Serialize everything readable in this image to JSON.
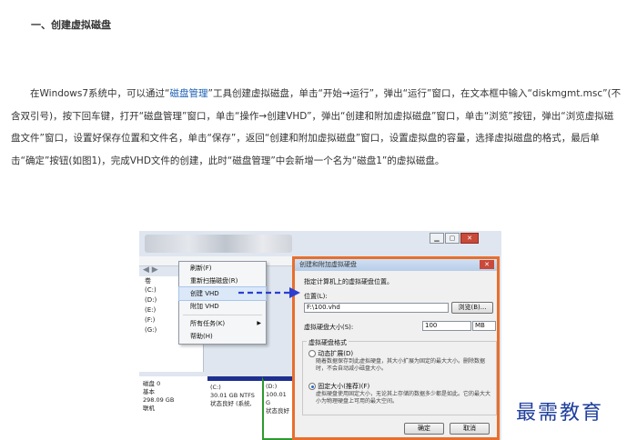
{
  "heading": "一、创建虚拟磁盘",
  "paragraph": {
    "part1": "在Windows7系统中，可以通过“",
    "link": "磁盘管理",
    "part2": "”工具创建虚拟磁盘，单击“开始→运行”，弹出“运行”窗口，在文本框中输入“diskmgmt.msc”(不含双引号)，按下回车键，打开“磁盘管理”窗口，单击“操作→创建VHD”，弹出“创建和附加虚拟磁盘”窗口，单击“浏览”按钮，弹出“浏览虚拟磁盘文件”窗口，设置好保存位置和文件名，单击“保存”，返回“创建和附加虚拟磁盘”窗口，设置虚拟盘的容量，选择虚拟磁盘的格式，最后单击“确定”按钮(如图1)，完成VHD文件的创建，此时“磁盘管理”中会新增一个名为“磁盘1”的虚拟磁盘。"
  },
  "screenshot": {
    "nav": "◀ ▶",
    "left_col_header": "卷",
    "volumes": [
      "(C:)",
      "(D:)",
      "(E:)",
      "(F:)",
      "(G:)"
    ],
    "menu": [
      {
        "label": "刷新(F)"
      },
      {
        "label": "重新扫描磁盘(R)"
      },
      {
        "label": "创建 VHD"
      },
      {
        "label": "附加 VHD"
      },
      {
        "label": "所有任务(K)",
        "arrow": "▶"
      },
      {
        "label": "帮助(H)"
      }
    ],
    "disk": {
      "name": "磁盘 0",
      "type": "基本",
      "size": "298.09 GB",
      "status": "联机",
      "c_label": "(C:)",
      "c_size": "30.01 GB NTFS",
      "c_status": "状态良好 (系统,",
      "d_label": "(D:)",
      "d_size": "100.01 G",
      "d_status": "状态良好"
    },
    "win_controls": {
      "min": "▁",
      "max": "▢",
      "close": "✕"
    },
    "dialog": {
      "title": "创建和附加虚拟硬盘",
      "close": "✕",
      "instruction": "指定计算机上的虚拟硬盘位置。",
      "location_label": "位置(L):",
      "location_value": "F:\\100.vhd",
      "browse": "浏览(B)...",
      "size_label": "虚拟硬盘大小(S):",
      "size_value": "100",
      "size_unit": "MB",
      "format_group": "虚拟硬盘格式",
      "dynamic_label": "动态扩展(D)",
      "dynamic_desc": "随着数据保存到此虚拟硬盘，其大小扩展为固定的最大大小。删除数据时，不会自动减小磁盘大小。",
      "fixed_label": "固定大小(推荐)(F)",
      "fixed_desc": "虚拟硬盘使用固定大小，无论其上存储的数据多少都是如此。它的最大大小为物理硬盘上可用的最大空间。",
      "ok": "确定",
      "cancel": "取消"
    }
  },
  "watermark": "最需教育"
}
